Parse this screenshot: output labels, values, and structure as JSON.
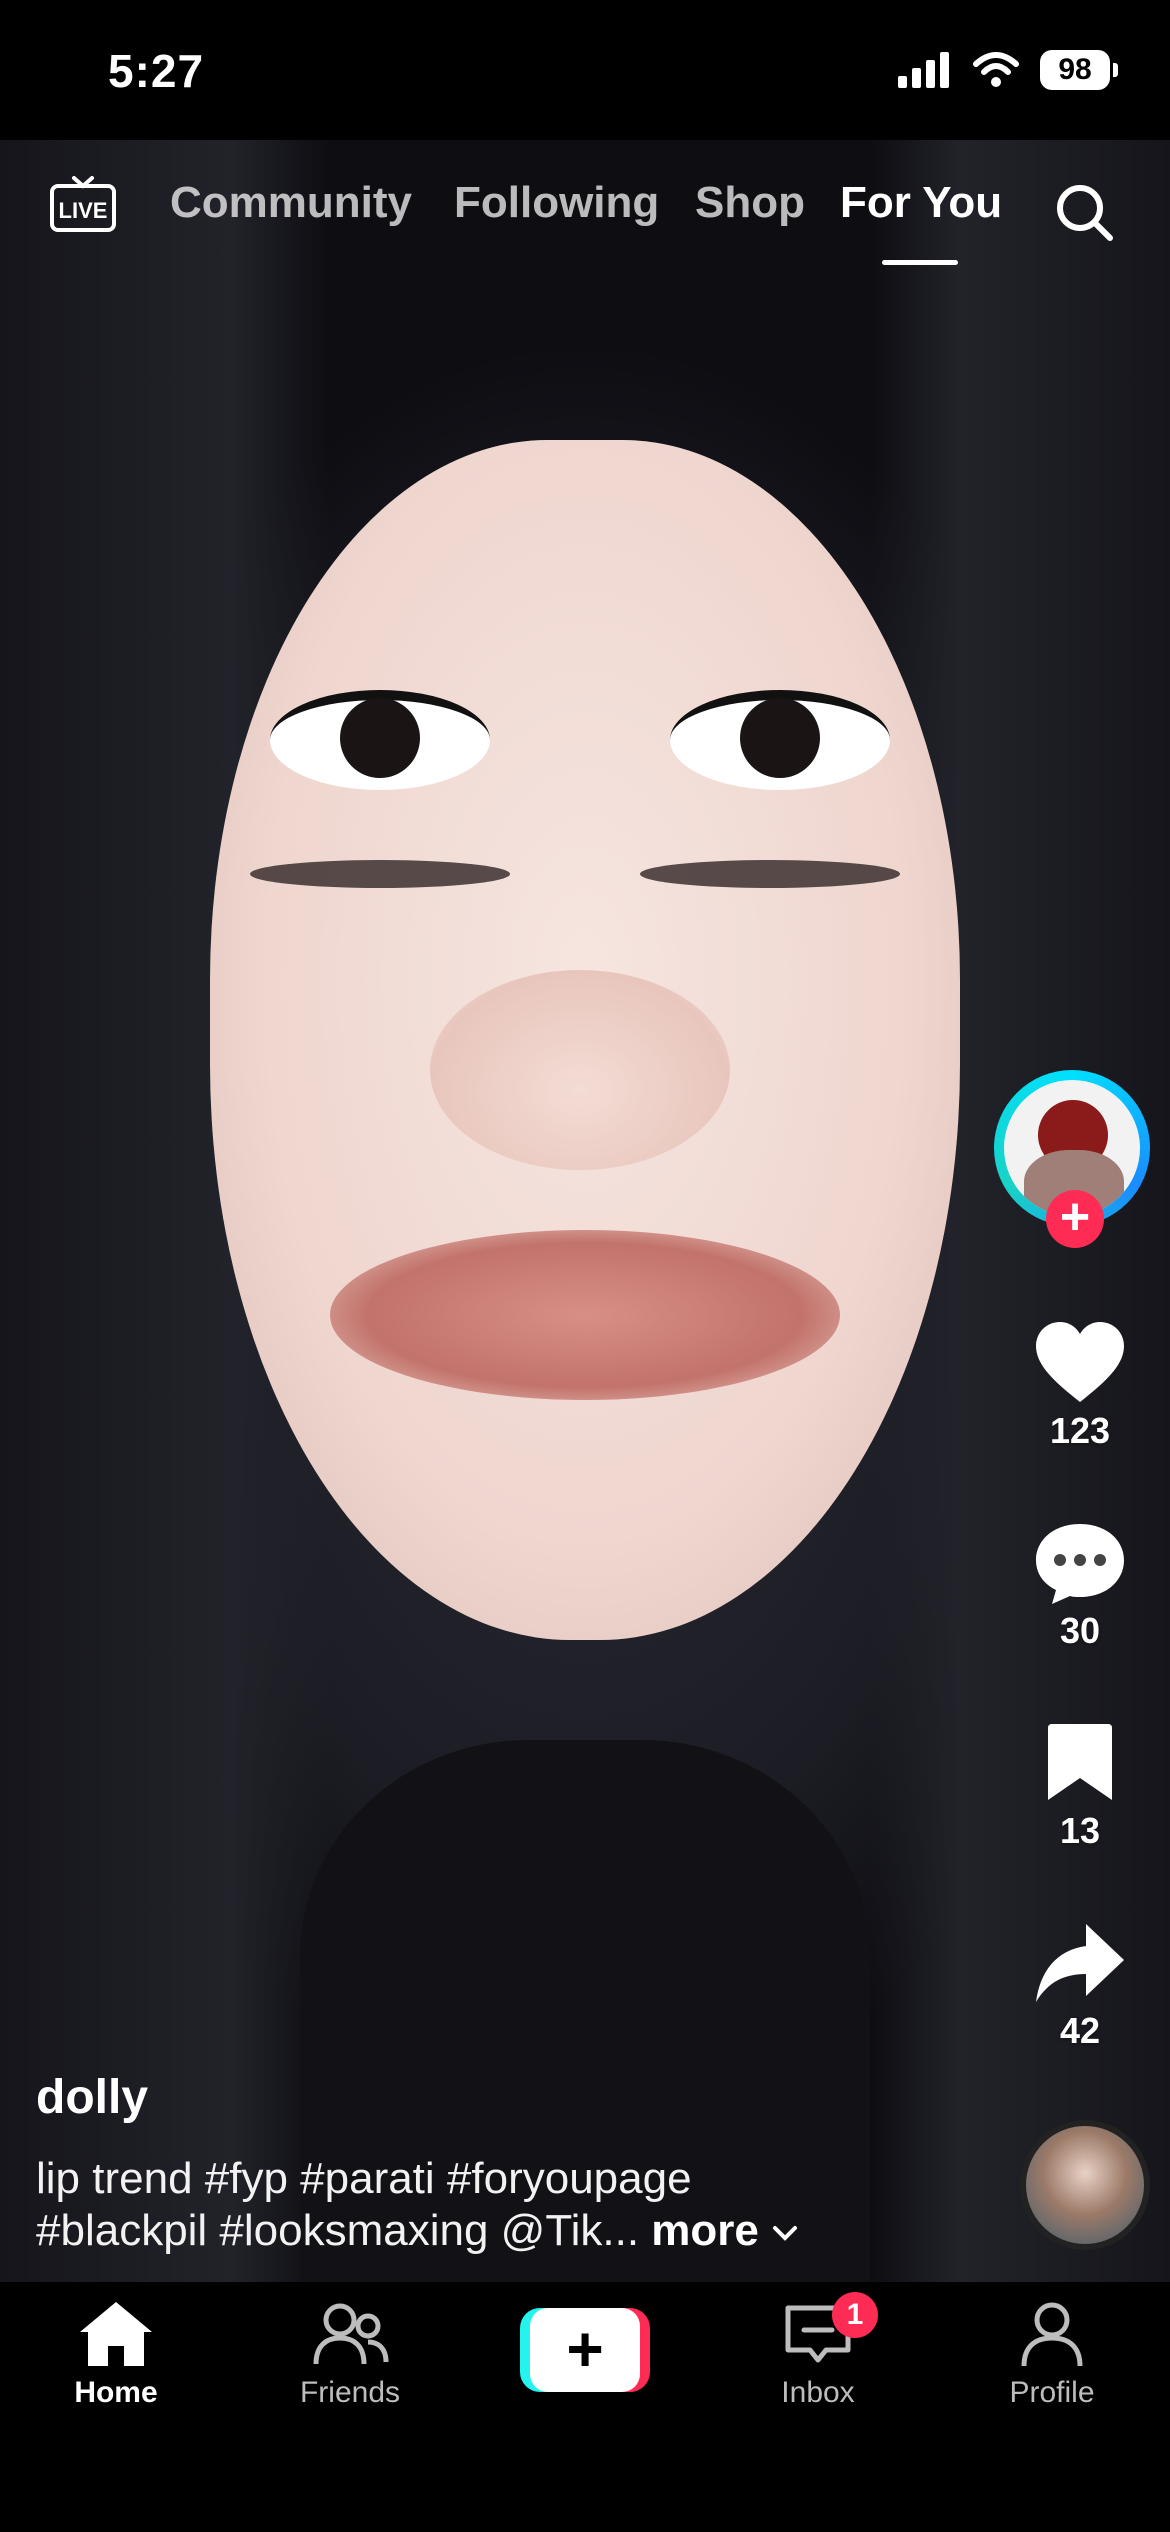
{
  "status_bar": {
    "time": "5:27",
    "battery": "98"
  },
  "top_nav": {
    "tabs": [
      {
        "label": "Community"
      },
      {
        "label": "Following"
      },
      {
        "label": "Shop"
      },
      {
        "label": "For You",
        "active": true
      }
    ]
  },
  "actions": {
    "likes": "123",
    "comments": "30",
    "saves": "13",
    "shares": "42"
  },
  "caption": {
    "author": "dolly",
    "line1": "lip trend  #fyp #parati #foryoupage",
    "line2": "#blackpil #looksmaxing @Tik... ",
    "more": "more"
  },
  "bottom_nav": {
    "home": "Home",
    "friends": "Friends",
    "inbox": "Inbox",
    "inbox_badge": "1",
    "profile": "Profile"
  },
  "colors": {
    "accent": "#fe2c55",
    "accent2": "#25f4ee"
  }
}
